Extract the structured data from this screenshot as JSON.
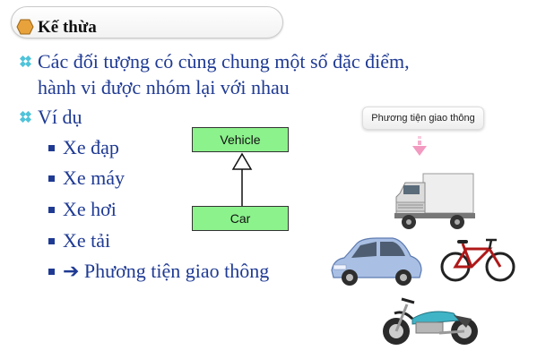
{
  "title": "Kế thừa",
  "bullets": [
    {
      "line1": "Các đối tượng có cùng chung một số đặc điểm,",
      "line2": "hành vi được nhóm lại với nhau"
    },
    {
      "line1": "Ví dụ"
    }
  ],
  "sub_items": [
    "Xe đạp",
    "Xe máy",
    "Xe hơi",
    "Xe tải",
    "➔ Phương tiện giao thông"
  ],
  "uml": {
    "parent": "Vehicle",
    "child": "Car"
  },
  "illustration": {
    "caption": "Phương tiện giao thông",
    "icons": [
      "truck-image",
      "car-image",
      "bicycle-image",
      "motorcycle-image"
    ]
  },
  "colors": {
    "text": "#1f3a93",
    "accent_diamond": "#4fc3d9",
    "uml_fill": "#8cf28c",
    "arrow_pink": "#f29ac0"
  }
}
